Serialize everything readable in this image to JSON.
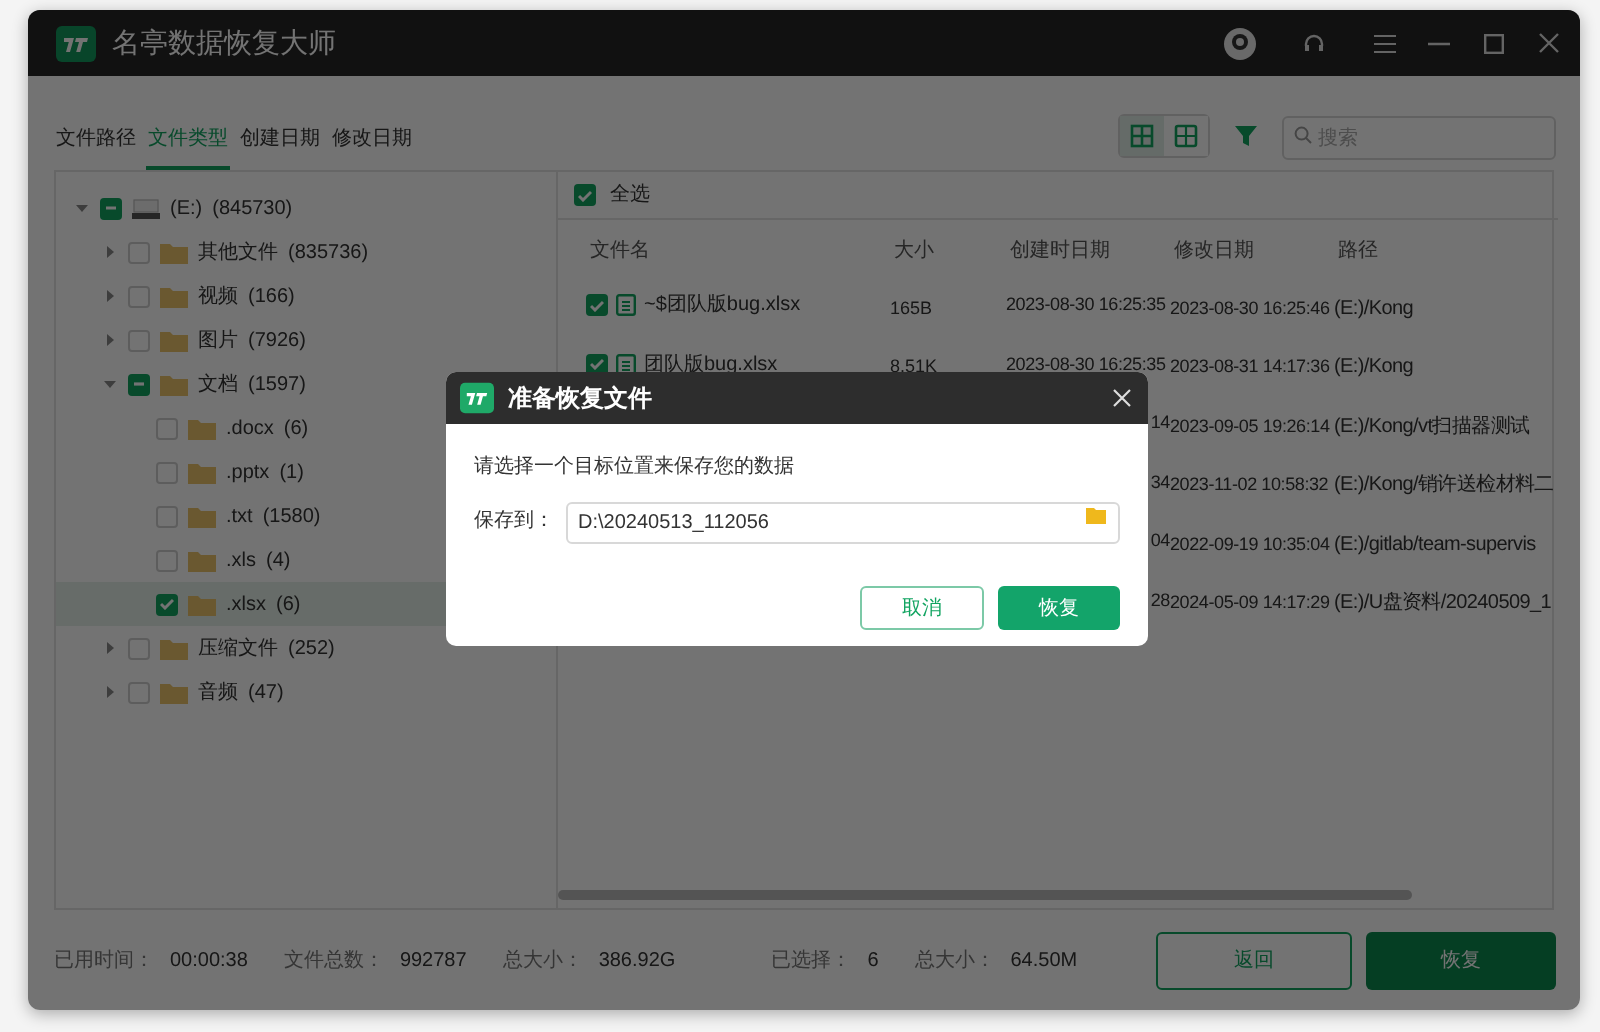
{
  "window": {
    "title": "名亭数据恢复大师"
  },
  "tabs": [
    {
      "label": "文件路径",
      "selected": false
    },
    {
      "label": "文件类型",
      "selected": true
    },
    {
      "label": "创建日期",
      "selected": false
    },
    {
      "label": "修改日期",
      "selected": false
    }
  ],
  "view_buttons": [
    {
      "kind": "grid-large",
      "selected": true
    },
    {
      "kind": "grid-small",
      "selected": false
    }
  ],
  "search": {
    "placeholder": "搜索"
  },
  "tree": [
    {
      "kind": "drive",
      "label": "(E:)",
      "count": "(845730)",
      "expanded": true,
      "checked": false,
      "indeterminate": true,
      "selected": false,
      "children": [
        {
          "kind": "folder",
          "label": "其他文件",
          "count": "(835736)",
          "expanded": false,
          "checked": false,
          "selected": false
        },
        {
          "kind": "folder",
          "label": "视频",
          "count": "(166)",
          "expanded": false,
          "checked": false,
          "selected": false
        },
        {
          "kind": "folder",
          "label": "图片",
          "count": "(7926)",
          "expanded": false,
          "checked": false,
          "selected": false
        },
        {
          "kind": "folder",
          "label": "文档",
          "count": "(1597)",
          "expanded": true,
          "checked": false,
          "indeterminate": true,
          "selected": false,
          "children": [
            {
              "kind": "folder",
              "label": ".docx",
              "count": "(6)",
              "checked": false,
              "selected": false
            },
            {
              "kind": "folder",
              "label": ".pptx",
              "count": "(1)",
              "checked": false,
              "selected": false
            },
            {
              "kind": "folder",
              "label": ".txt",
              "count": "(1580)",
              "checked": false,
              "selected": false
            },
            {
              "kind": "folder",
              "label": ".xls",
              "count": "(4)",
              "checked": false,
              "selected": false
            },
            {
              "kind": "folder",
              "label": ".xlsx",
              "count": "(6)",
              "checked": true,
              "selected": true
            }
          ]
        },
        {
          "kind": "folder",
          "label": "压缩文件",
          "count": "(252)",
          "expanded": false,
          "checked": false,
          "selected": false
        },
        {
          "kind": "folder",
          "label": "音频",
          "count": "(47)",
          "expanded": false,
          "checked": false,
          "selected": false
        }
      ]
    }
  ],
  "select_all": {
    "label": "全选",
    "checked": true
  },
  "table": {
    "columns": [
      "文件名",
      "大小",
      "创建时日期",
      "修改日期",
      "路径"
    ],
    "rows": [
      {
        "checked": true,
        "name": "~$团队版bug.xlsx",
        "size": "165B",
        "created": "2023-08-30 16:25:35",
        "modified": "2023-08-30 16:25:46",
        "path": "(E:)/Kong"
      },
      {
        "checked": true,
        "name": "团队版bug.xlsx",
        "size": "8.51K",
        "created": "2023-08-30 16:25:35",
        "modified": "2023-08-31 14:17:36",
        "path": "(E:)/Kong"
      },
      {
        "created": "14",
        "modified": "2023-09-05 19:26:14",
        "path": "(E:)/Kong/vt扫描器测试"
      },
      {
        "created": "34",
        "modified": "2023-11-02 10:58:32",
        "path": "(E:)/Kong/销许送检材料二"
      },
      {
        "created": "04",
        "modified": "2022-09-19 10:35:04",
        "path": "(E:)/gitlab/team-supervis"
      },
      {
        "created": "28",
        "modified": "2024-05-09 14:17:29",
        "path": "(E:)/U盘资料/20240509_1"
      }
    ]
  },
  "status_bar": [
    {
      "label": "已用时间：",
      "value": "00:00:38"
    },
    {
      "label": "文件总数：",
      "value": "992787"
    },
    {
      "label": "总大小：",
      "value": "386.92G"
    },
    {
      "label": "已选择：",
      "value": "6"
    },
    {
      "label": "总大小：",
      "value": "64.50M"
    }
  ],
  "footer_buttons": [
    {
      "kind": "secondary",
      "label": "返回"
    },
    {
      "kind": "primary",
      "label": "恢复"
    }
  ],
  "dialog": {
    "title": "准备恢复文件",
    "message": "请选择一个目标位置来保存您的数据",
    "field_label": "保存到：",
    "field_value": "D:\\20240513_112056",
    "buttons": [
      {
        "kind": "secondary",
        "label": "取消"
      },
      {
        "kind": "primary",
        "label": "恢复"
      }
    ]
  }
}
